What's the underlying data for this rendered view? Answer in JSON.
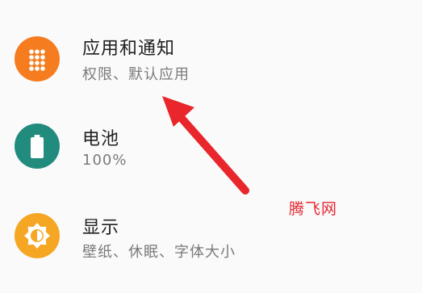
{
  "settings_items": [
    {
      "title": "应用和通知",
      "subtitle": "权限、默认应用",
      "icon": "apps-grid-icon",
      "color": "#f57c1f"
    },
    {
      "title": "电池",
      "subtitle": "100%",
      "icon": "battery-icon",
      "color": "#218c7e"
    },
    {
      "title": "显示",
      "subtitle": "壁纸、休眠、字体大小",
      "icon": "brightness-icon",
      "color": "#f5a623"
    }
  ],
  "annotation": {
    "arrow_color": "#e8262b"
  },
  "watermark": "腾飞网",
  "background": "#fafafa"
}
